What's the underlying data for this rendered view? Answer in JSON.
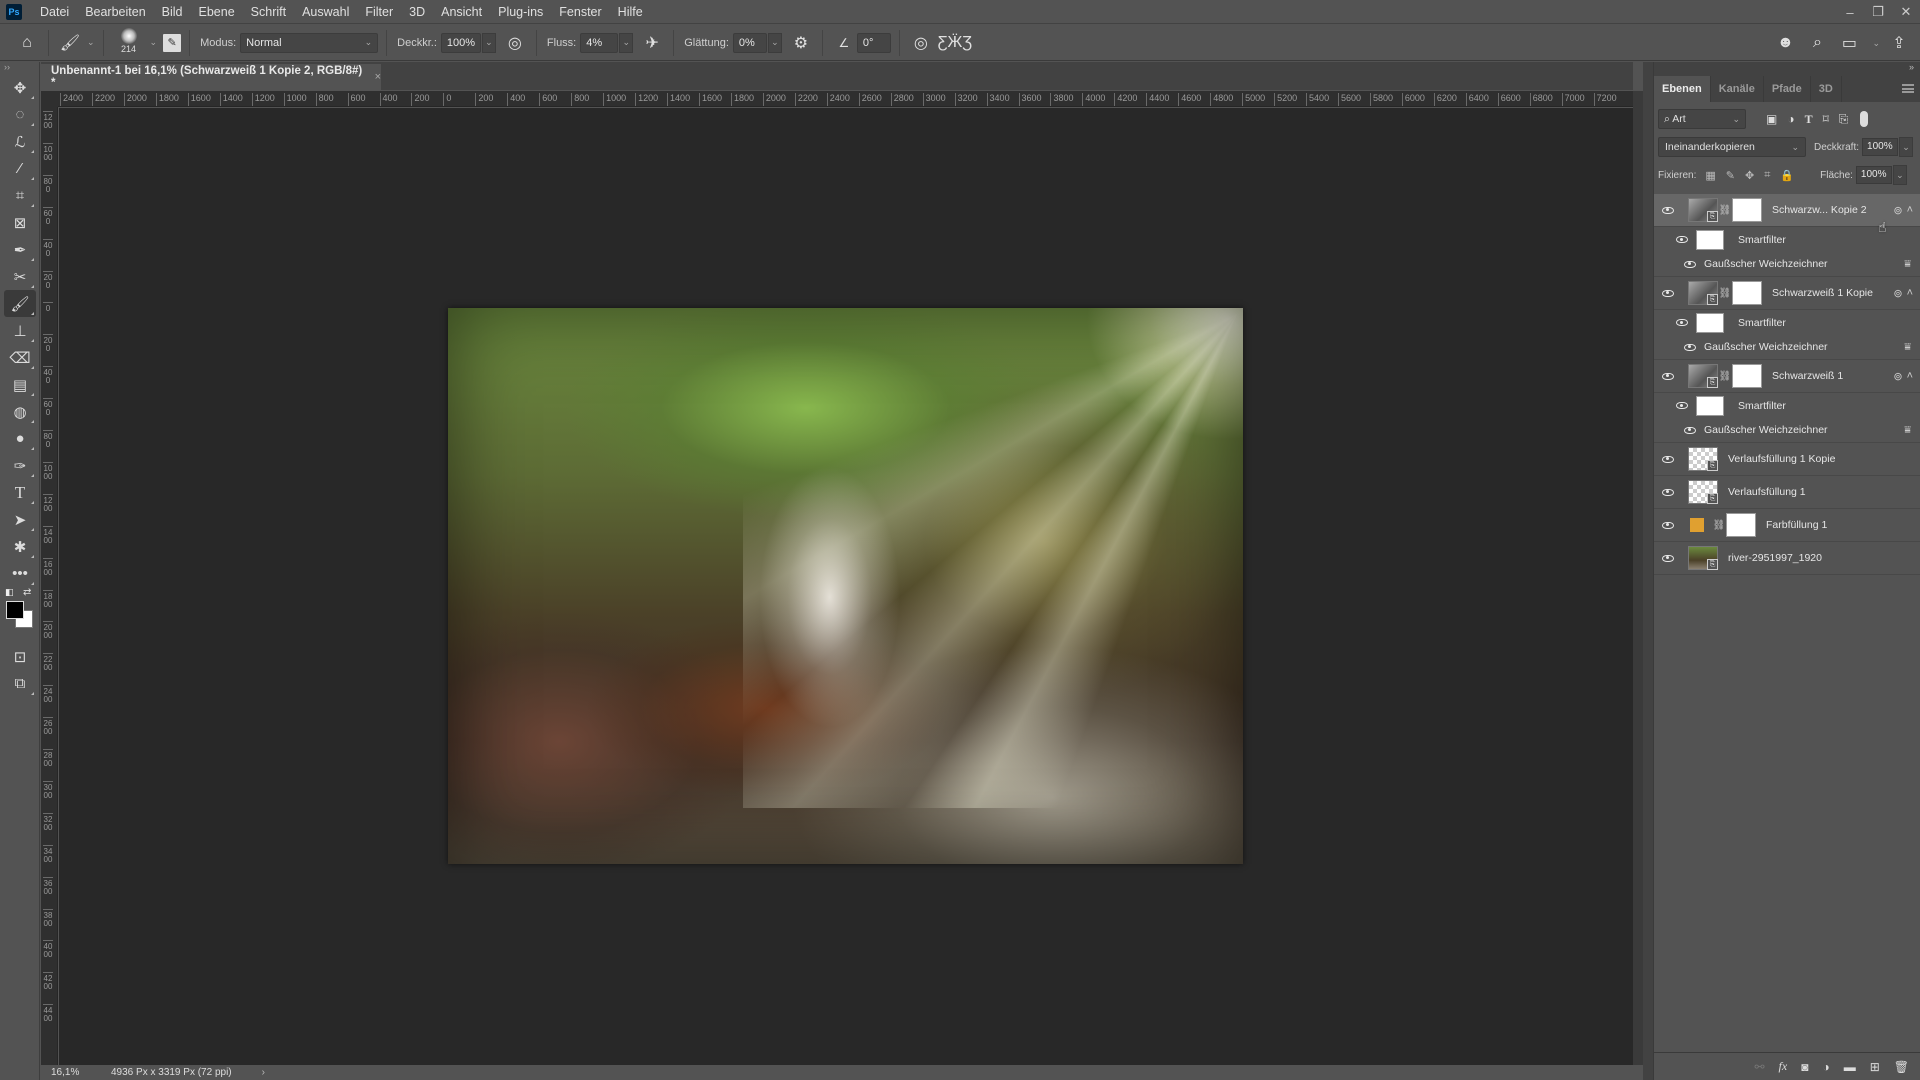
{
  "app": {
    "logo": "Ps",
    "menu": [
      "Datei",
      "Bearbeiten",
      "Bild",
      "Ebene",
      "Schrift",
      "Auswahl",
      "Filter",
      "3D",
      "Ansicht",
      "Plug-ins",
      "Fenster",
      "Hilfe"
    ],
    "window_controls": {
      "minimize": "–",
      "restore": "❐",
      "close": "✕"
    }
  },
  "options_bar": {
    "brush_size": "214",
    "mode_label": "Modus:",
    "mode_value": "Normal",
    "opacity_label": "Deckkr.:",
    "opacity_value": "100%",
    "flow_label": "Fluss:",
    "flow_value": "4%",
    "smoothing_label": "Glättung:",
    "smoothing_value": "0%",
    "angle_value": "0°"
  },
  "document": {
    "tab_title": "Unbenannt-1 bei 16,1% (Schwarzweiß 1 Kopie 2, RGB/8#) *",
    "tab_close": "×",
    "ruler_h": [
      "2400",
      "2200",
      "2000",
      "1800",
      "1600",
      "1400",
      "1200",
      "1000",
      "800",
      "600",
      "400",
      "200",
      "0",
      "200",
      "400",
      "600",
      "800",
      "1000",
      "1200",
      "1400",
      "1600",
      "1800",
      "2000",
      "2200",
      "2400",
      "2600",
      "2800",
      "3000",
      "3200",
      "3400",
      "3600",
      "3800",
      "4000",
      "4200",
      "4400",
      "4600",
      "4800",
      "5000",
      "5200",
      "5400",
      "5600",
      "5800",
      "6000",
      "6200",
      "6400",
      "6600",
      "6800",
      "7000",
      "7200"
    ],
    "ruler_v": [
      "1200",
      "1000",
      "800",
      "600",
      "400",
      "200",
      "0",
      "200",
      "400",
      "600",
      "800",
      "1000",
      "1200",
      "1400",
      "1600",
      "1800",
      "2000",
      "2200",
      "2400",
      "2600",
      "2800",
      "3000",
      "3200",
      "3400",
      "3600",
      "3800",
      "4000",
      "4200",
      "4400"
    ]
  },
  "status": {
    "zoom": "16,1%",
    "info": "4936 Px x 3319 Px (72 ppi)",
    "arrow": "›"
  },
  "layers_panel": {
    "collapse": "»",
    "tabs": [
      "Ebenen",
      "Kanäle",
      "Pfade",
      "3D"
    ],
    "active_tab": "Ebenen",
    "filter_kind": "Art",
    "blend_mode": "Ineinanderkopieren",
    "opacity_label": "Deckkraft:",
    "opacity_value": "100%",
    "lock_label": "Fixieren:",
    "fill_label": "Fläche:",
    "fill_value": "100%",
    "layers": [
      {
        "name": "Schwarzw... Kopie 2",
        "type": "smart-object",
        "visible": true,
        "selected": true,
        "smartfilter_label": "Smartfilter",
        "filter": "Gaußscher Weichzeichner"
      },
      {
        "name": "Schwarzweiß 1 Kopie",
        "type": "smart-object",
        "visible": true,
        "selected": false,
        "smartfilter_label": "Smartfilter",
        "filter": "Gaußscher Weichzeichner"
      },
      {
        "name": "Schwarzweiß 1",
        "type": "smart-object",
        "visible": true,
        "selected": false,
        "smartfilter_label": "Smartfilter",
        "filter": "Gaußscher Weichzeichner"
      },
      {
        "name": "Verlaufsfüllung 1 Kopie",
        "type": "smart-object",
        "visible": true
      },
      {
        "name": "Verlaufsfüllung 1",
        "type": "smart-object",
        "visible": true
      },
      {
        "name": "Farbfüllung 1",
        "type": "fill",
        "visible": true,
        "color": "#e0a030"
      },
      {
        "name": "river-2951997_1920",
        "type": "smart-object",
        "visible": true
      }
    ]
  },
  "colors": {
    "foreground": "#000000",
    "background": "#ffffff",
    "ui_bg": "#535353",
    "canvas_bg": "#282828"
  }
}
